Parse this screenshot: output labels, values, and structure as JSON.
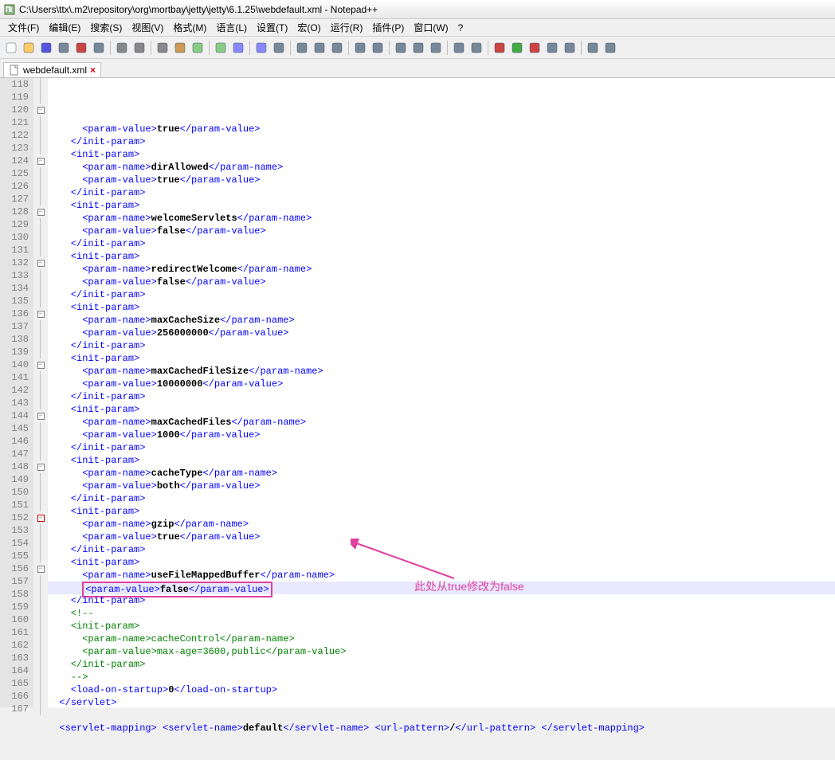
{
  "window": {
    "title": "C:\\Users\\ttx\\.m2\\repository\\org\\mortbay\\jetty\\jetty\\6.1.25\\webdefault.xml - Notepad++"
  },
  "menu": {
    "file": "文件(F)",
    "edit": "编辑(E)",
    "search": "搜索(S)",
    "view": "视图(V)",
    "format": "格式(M)",
    "language": "语言(L)",
    "settings": "设置(T)",
    "macro": "宏(O)",
    "run": "运行(R)",
    "plugins": "插件(P)",
    "window": "窗口(W)",
    "help": "?"
  },
  "tab": {
    "name": "webdefault.xml"
  },
  "annotation": {
    "text": "此处从true修改为false"
  },
  "lines": [
    {
      "n": "118",
      "fold": "|",
      "html": "      <span class='tag'>&lt;param-value&gt;</span><span class='text'>true</span><span class='tag'>&lt;/param-value&gt;</span>"
    },
    {
      "n": "119",
      "fold": "|",
      "html": "    <span class='tag'>&lt;/init-param&gt;</span>"
    },
    {
      "n": "120",
      "fold": "box",
      "html": "    <span class='tag'>&lt;init-param&gt;</span>"
    },
    {
      "n": "121",
      "fold": "|",
      "html": "      <span class='tag'>&lt;param-name&gt;</span><span class='text'>dirAllowed</span><span class='tag'>&lt;/param-name&gt;</span>"
    },
    {
      "n": "122",
      "fold": "|",
      "html": "      <span class='tag'>&lt;param-value&gt;</span><span class='text'>true</span><span class='tag'>&lt;/param-value&gt;</span>"
    },
    {
      "n": "123",
      "fold": "|",
      "html": "    <span class='tag'>&lt;/init-param&gt;</span>"
    },
    {
      "n": "124",
      "fold": "box",
      "html": "    <span class='tag'>&lt;init-param&gt;</span>"
    },
    {
      "n": "125",
      "fold": "|",
      "html": "      <span class='tag'>&lt;param-name&gt;</span><span class='text'>welcomeServlets</span><span class='tag'>&lt;/param-name&gt;</span>"
    },
    {
      "n": "126",
      "fold": "|",
      "html": "      <span class='tag'>&lt;param-value&gt;</span><span class='text'>false</span><span class='tag'>&lt;/param-value&gt;</span>"
    },
    {
      "n": "127",
      "fold": "|",
      "html": "    <span class='tag'>&lt;/init-param&gt;</span>"
    },
    {
      "n": "128",
      "fold": "box",
      "html": "    <span class='tag'>&lt;init-param&gt;</span>"
    },
    {
      "n": "129",
      "fold": "|",
      "html": "      <span class='tag'>&lt;param-name&gt;</span><span class='text'>redirectWelcome</span><span class='tag'>&lt;/param-name&gt;</span>"
    },
    {
      "n": "130",
      "fold": "|",
      "html": "      <span class='tag'>&lt;param-value&gt;</span><span class='text'>false</span><span class='tag'>&lt;/param-value&gt;</span>"
    },
    {
      "n": "131",
      "fold": "|",
      "html": "    <span class='tag'>&lt;/init-param&gt;</span>"
    },
    {
      "n": "132",
      "fold": "box",
      "html": "    <span class='tag'>&lt;init-param&gt;</span>"
    },
    {
      "n": "133",
      "fold": "|",
      "html": "      <span class='tag'>&lt;param-name&gt;</span><span class='text'>maxCacheSize</span><span class='tag'>&lt;/param-name&gt;</span>"
    },
    {
      "n": "134",
      "fold": "|",
      "html": "      <span class='tag'>&lt;param-value&gt;</span><span class='text'>256000000</span><span class='tag'>&lt;/param-value&gt;</span>"
    },
    {
      "n": "135",
      "fold": "|",
      "html": "    <span class='tag'>&lt;/init-param&gt;</span>"
    },
    {
      "n": "136",
      "fold": "box",
      "html": "    <span class='tag'>&lt;init-param&gt;</span>"
    },
    {
      "n": "137",
      "fold": "|",
      "html": "      <span class='tag'>&lt;param-name&gt;</span><span class='text'>maxCachedFileSize</span><span class='tag'>&lt;/param-name&gt;</span>"
    },
    {
      "n": "138",
      "fold": "|",
      "html": "      <span class='tag'>&lt;param-value&gt;</span><span class='text'>10000000</span><span class='tag'>&lt;/param-value&gt;</span>"
    },
    {
      "n": "139",
      "fold": "|",
      "html": "    <span class='tag'>&lt;/init-param&gt;</span>"
    },
    {
      "n": "140",
      "fold": "box",
      "html": "    <span class='tag'>&lt;init-param&gt;</span>"
    },
    {
      "n": "141",
      "fold": "|",
      "html": "      <span class='tag'>&lt;param-name&gt;</span><span class='text'>maxCachedFiles</span><span class='tag'>&lt;/param-name&gt;</span>"
    },
    {
      "n": "142",
      "fold": "|",
      "html": "      <span class='tag'>&lt;param-value&gt;</span><span class='text'>1000</span><span class='tag'>&lt;/param-value&gt;</span>"
    },
    {
      "n": "143",
      "fold": "|",
      "html": "    <span class='tag'>&lt;/init-param&gt;</span>"
    },
    {
      "n": "144",
      "fold": "box",
      "html": "    <span class='tag'>&lt;init-param&gt;</span>"
    },
    {
      "n": "145",
      "fold": "|",
      "html": "      <span class='tag'>&lt;param-name&gt;</span><span class='text'>cacheType</span><span class='tag'>&lt;/param-name&gt;</span>"
    },
    {
      "n": "146",
      "fold": "|",
      "html": "      <span class='tag'>&lt;param-value&gt;</span><span class='text'>both</span><span class='tag'>&lt;/param-value&gt;</span>"
    },
    {
      "n": "147",
      "fold": "|",
      "html": "    <span class='tag'>&lt;/init-param&gt;</span>"
    },
    {
      "n": "148",
      "fold": "box",
      "html": "    <span class='tag'>&lt;init-param&gt;</span>"
    },
    {
      "n": "149",
      "fold": "|",
      "html": "      <span class='tag'>&lt;param-name&gt;</span><span class='text'>gzip</span><span class='tag'>&lt;/param-name&gt;</span>"
    },
    {
      "n": "150",
      "fold": "|",
      "html": "      <span class='tag'>&lt;param-value&gt;</span><span class='text'>true</span><span class='tag'>&lt;/param-value&gt;</span>"
    },
    {
      "n": "151",
      "fold": "|",
      "html": "    <span class='tag'>&lt;/init-param&gt;</span>"
    },
    {
      "n": "152",
      "fold": "box",
      "boxcolor": "red",
      "html": "    <span class='tag'>&lt;init-param&gt;</span>"
    },
    {
      "n": "153",
      "fold": "|",
      "html": "      <span class='tag'>&lt;param-name&gt;</span><span class='text'>useFileMappedBuffer</span><span class='tag'>&lt;/param-name&gt;</span>"
    },
    {
      "n": "154",
      "fold": "|",
      "hl": true,
      "box": true,
      "html": "      <span class='tag'>&lt;param-value&gt;</span><span class='text'>false</span><span class='tag'>&lt;/param-value&gt;</span>"
    },
    {
      "n": "155",
      "fold": "|",
      "html": "    <span class='tag'>&lt;/init-param&gt;</span>"
    },
    {
      "n": "156",
      "fold": "box",
      "html": "    <span class='comment'>&lt;!--</span>"
    },
    {
      "n": "157",
      "fold": "|",
      "html": "    <span class='comment'>&lt;init-param&gt;</span>"
    },
    {
      "n": "158",
      "fold": "|",
      "html": "      <span class='comment'>&lt;param-name&gt;cacheControl&lt;/param-name&gt;</span>"
    },
    {
      "n": "159",
      "fold": "|",
      "html": "      <span class='comment'>&lt;param-value&gt;max-age=3600,public&lt;/param-value&gt;</span>"
    },
    {
      "n": "160",
      "fold": "|",
      "html": "    <span class='comment'>&lt;/init-param&gt;</span>"
    },
    {
      "n": "161",
      "fold": "|",
      "html": "    <span class='comment'>--&gt;</span>"
    },
    {
      "n": "162",
      "fold": "|",
      "html": "    <span class='tag'>&lt;load-on-startup&gt;</span><span class='text'>0</span><span class='tag'>&lt;/load-on-startup&gt;</span>"
    },
    {
      "n": "163",
      "fold": "|",
      "html": "  <span class='tag'>&lt;/servlet&gt;</span>"
    },
    {
      "n": "164",
      "fold": "|",
      "html": ""
    },
    {
      "n": "165",
      "fold": "|",
      "html": "  <span class='tag'>&lt;servlet-mapping&gt;</span> <span class='tag'>&lt;servlet-name&gt;</span><span class='text'>default</span><span class='tag'>&lt;/servlet-name&gt;</span> <span class='tag'>&lt;url-pattern&gt;</span><span class='text'>/</span><span class='tag'>&lt;/url-pattern&gt;</span> <span class='tag'>&lt;/servlet-mapping&gt;</span>"
    },
    {
      "n": "166",
      "fold": "|",
      "html": ""
    },
    {
      "n": "167",
      "fold": "|",
      "html": ""
    }
  ],
  "toolbar_icons": [
    "new",
    "open",
    "save",
    "save-all",
    "close",
    "close-all",
    "print",
    "cut",
    "copy",
    "paste",
    "undo",
    "redo",
    "find",
    "replace",
    "zoom-in",
    "zoom-out",
    "sync",
    "wordwrap",
    "show-all",
    "indent-guide",
    "lang",
    "fold-all",
    "unfold-all",
    "comment",
    "uncomment",
    "record",
    "play",
    "stop",
    "playback",
    "run",
    "show-func",
    "spell"
  ]
}
